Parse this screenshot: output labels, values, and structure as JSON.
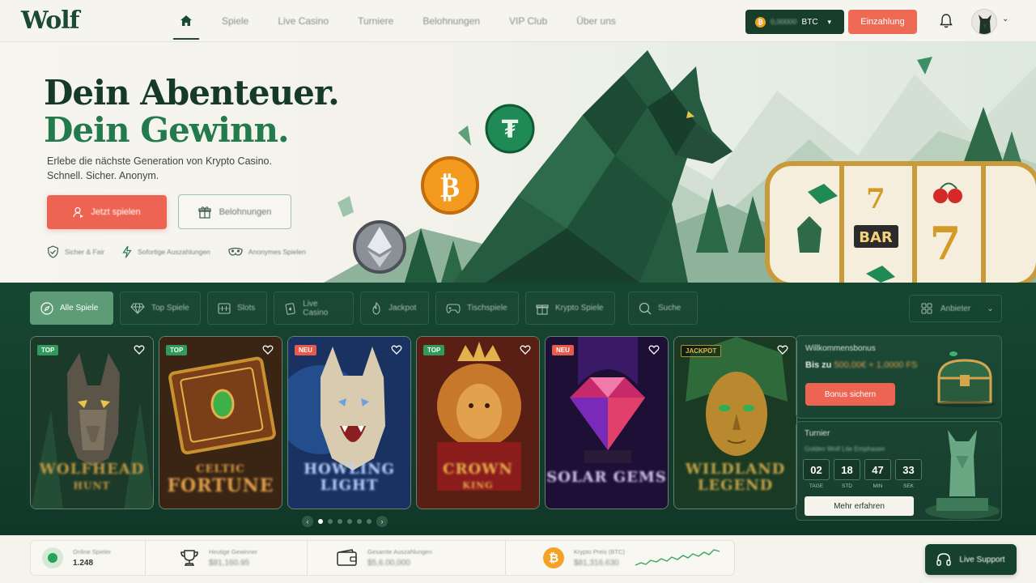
{
  "brand": {
    "logo": "Wolf"
  },
  "nav": {
    "items": [
      "Spiele",
      "Live Casino",
      "Turniere",
      "Belohnungen",
      "VIP Club",
      "Über uns"
    ]
  },
  "wallet": {
    "amount": "0,00000",
    "currency": "BTC"
  },
  "header": {
    "deposit_label": "Einzahlung"
  },
  "hero": {
    "title_line1": "Dein Abenteuer.",
    "title_line2": "Dein Gewinn.",
    "subtitle_line1": "Erlebe die nächste Generation von Krypto Casino.",
    "subtitle_line2": "Schnell. Sicher. Anonym.",
    "play_label": "Jetzt spielen",
    "rewards_label": "Belohnungen",
    "features": [
      "Sicher & Fair",
      "Sofortige Auszahlungen",
      "Anonymes Spielen"
    ]
  },
  "tabs": [
    "Alle Spiele",
    "Top Spiele",
    "Slots",
    "Live Casino",
    "Jackpot",
    "Tischspiele",
    "Krypto Spiele"
  ],
  "search_label": "Suche",
  "provider_label": "Anbieter",
  "games": [
    {
      "badge": "TOP",
      "title_l1": "WOLFHEAD",
      "title_l2": "HUNT"
    },
    {
      "badge": "TOP",
      "title_l1": "CELTIC",
      "title_l2": "FORTUNE"
    },
    {
      "badge": "NEU",
      "title_l1": "HOWLING",
      "title_l2": "LIGHT"
    },
    {
      "badge": "TOP",
      "title_l1": "CROWN",
      "title_l2": "KING"
    },
    {
      "badge": "NEU",
      "title_l1": "SOLAR GEMS",
      "title_l2": ""
    },
    {
      "badge": "JACKPOT",
      "title_l1": "WILDLAND",
      "title_l2": "LEGEND"
    }
  ],
  "bonus": {
    "title": "Willkommensbonus",
    "line_prefix": "Bis zu",
    "line_value": "500,00€ + 1,0000 FS",
    "button": "Bonus sichern"
  },
  "tournament": {
    "title": "Turnier",
    "subtitle": "Golden Wolf Lite Emphasen",
    "timer": [
      {
        "value": "02",
        "unit": "TAGE"
      },
      {
        "value": "18",
        "unit": "STD"
      },
      {
        "value": "47",
        "unit": "MIN"
      },
      {
        "value": "33",
        "unit": "SEK"
      }
    ],
    "button": "Mehr erfahren"
  },
  "stats": [
    {
      "label": "Online Spieler",
      "value": "1.248"
    },
    {
      "label": "Heutige Gewinner",
      "value": "$81,160.95"
    },
    {
      "label": "Gesamte Auszahlungen",
      "value": "$5,6.00,000"
    },
    {
      "label": "Krypto Preis (BTC)",
      "value": "$81,316.630"
    }
  ],
  "support": {
    "label": "Live Support"
  },
  "colors": {
    "brand_green": "#173d2b",
    "accent_coral": "#ee6452",
    "section_green": "#133d2b",
    "gold": "#e1b64a"
  }
}
